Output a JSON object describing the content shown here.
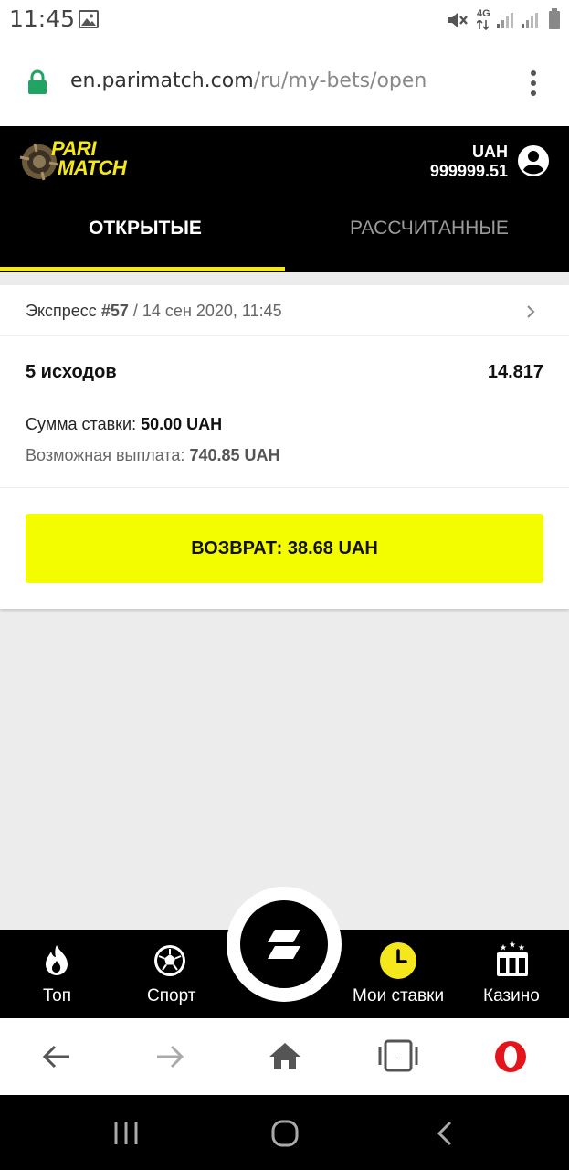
{
  "status_bar": {
    "time": "11:45",
    "icons": [
      "image-icon",
      "mute-icon",
      "4g-signal-icon",
      "signal-icon",
      "signal-icon",
      "battery-icon"
    ],
    "network_label": "4G"
  },
  "address_bar": {
    "domain": "en.parimatch.com",
    "path": "/ru/my-bets/open",
    "lock_color": "#1fa463"
  },
  "header": {
    "logo_top": "PARI",
    "logo_bottom": "MATCH",
    "currency": "UAH",
    "balance": "999999.51",
    "accent_color": "#f4e81c"
  },
  "tabs": [
    {
      "label": "ОТКРЫТЫЕ",
      "active": true
    },
    {
      "label": "РАССЧИТАННЫЕ",
      "active": false
    }
  ],
  "bet": {
    "type": "Экспресс",
    "number": "#57",
    "separator": "/",
    "datetime": "14 сен 2020, 11:45",
    "outcomes": "5 исходов",
    "odds": "14.817",
    "stake_label": "Сумма ставки:",
    "stake_value": "50.00 UAH",
    "payout_label": "Возможная выплата:",
    "payout_value": "740.85 UAH",
    "refund_button": "ВОЗВРАТ: 38.68 UAH",
    "refund_color": "#f4fc00"
  },
  "bottom_nav": [
    {
      "label": "Топ",
      "icon": "fire-icon"
    },
    {
      "label": "Спорт",
      "icon": "soccer-ball-icon"
    },
    {
      "label": "",
      "icon": "parimatch-logo-icon"
    },
    {
      "label": "Мои ставки",
      "icon": "clock-icon"
    },
    {
      "label": "Казино",
      "icon": "casino-icon"
    }
  ],
  "browser_bar": {
    "icons": [
      "back-arrow-icon",
      "forward-arrow-icon",
      "home-icon",
      "tabs-icon",
      "opera-icon"
    ],
    "tabs_badge": "..."
  },
  "system_nav": {
    "icons": [
      "recent-apps-icon",
      "home-circle-icon",
      "back-chevron-icon"
    ]
  }
}
